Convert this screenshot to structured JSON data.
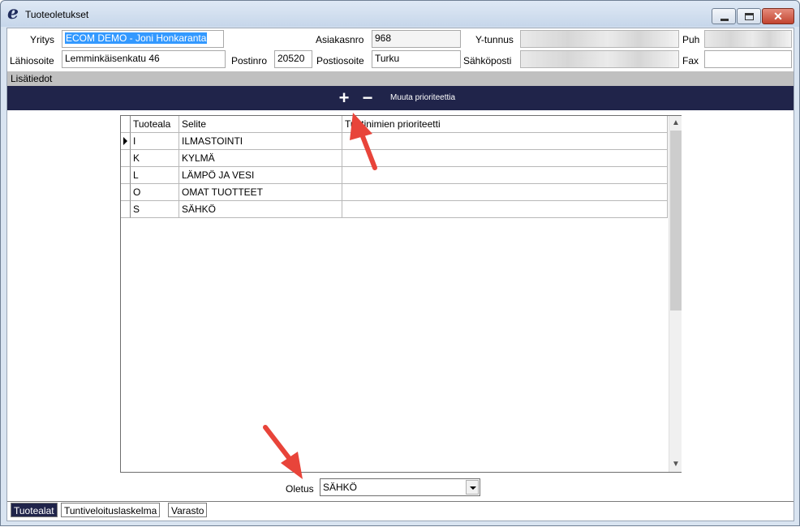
{
  "window": {
    "title": "Tuoteoletukset",
    "app_icon_glyph": "e",
    "buttons": {
      "minimize": "minimize-icon",
      "maximize": "maximize-icon",
      "close": "close-icon",
      "close_glyph": "✕"
    }
  },
  "form": {
    "yritys_label": "Yritys",
    "yritys_value": "ECOM DEMO - Joni Honkaranta",
    "asiakasnro_label": "Asiakasnro",
    "asiakasnro_value": "968",
    "ytunnus_label": "Y-tunnus",
    "puh_label": "Puh",
    "lahiosoite_label": "Lähiosoite",
    "lahiosoite_value": "Lemminkäisenkatu 46",
    "postinro_label": "Postinro",
    "postinro_value": "20520",
    "postiosoite_label": "Postiosoite",
    "postiosoite_value": "Turku",
    "sahkoposti_label": "Sähköposti",
    "fax_label": "Fax"
  },
  "section": {
    "lisatiedot": "Lisätiedot"
  },
  "toolbar": {
    "plus": "+",
    "minus": "−",
    "change_priority": "Muuta prioriteettia"
  },
  "grid": {
    "columns": [
      "Tuoteala",
      "Selite",
      "Tuntinimien prioriteetti"
    ],
    "rows": [
      {
        "code": "I",
        "desc": "ILMASTOINTI",
        "prio": ""
      },
      {
        "code": "K",
        "desc": "KYLMÄ",
        "prio": ""
      },
      {
        "code": "L",
        "desc": "LÄMPÖ JA VESI",
        "prio": ""
      },
      {
        "code": "O",
        "desc": "OMAT TUOTTEET",
        "prio": ""
      },
      {
        "code": "S",
        "desc": "SÄHKÖ",
        "prio": ""
      }
    ]
  },
  "oletus": {
    "label": "Oletus",
    "value": "SÄHKÖ"
  },
  "tabs": [
    "Tuotealat",
    "Tuntiveloituslaskelma",
    "Varasto"
  ],
  "colors": {
    "accent": "#20244a",
    "selection": "#3399ff",
    "annotation": "#e8443a"
  }
}
